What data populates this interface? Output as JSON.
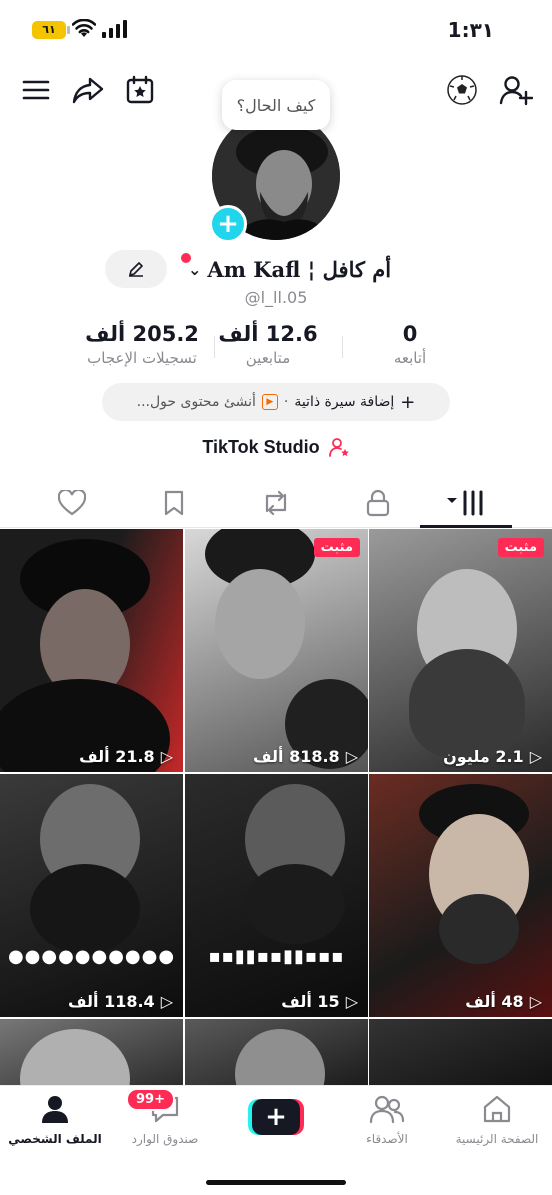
{
  "status_bar": {
    "time": "1:٣١",
    "battery": "٦١"
  },
  "profile": {
    "note_bubble": "كيف الحال؟",
    "display_name": "أم كافل ¦ Am Kafl",
    "username": "@l_ll.05",
    "stats": [
      {
        "value": "0",
        "label": "أتابعه"
      },
      {
        "value": "12.6 ألف",
        "label": "متابعين"
      },
      {
        "value": "205.2 ألف",
        "label": "تسجيلات الإعجاب"
      }
    ],
    "bio_add": "إضافة سيرة ذاتية",
    "bio_create": "أنشئ محتوى حول...",
    "studio_label": "TikTok Studio"
  },
  "videos": [
    {
      "views": "2.1 مليون",
      "pinned": "مثبت"
    },
    {
      "views": "818.8 ألف",
      "pinned": "مثبت"
    },
    {
      "views": "21.8 ألف",
      "pinned": ""
    },
    {
      "views": "48 ألف",
      "pinned": ""
    },
    {
      "views": "15 ألف",
      "pinned": ""
    },
    {
      "views": "118.4 ألف",
      "pinned": ""
    }
  ],
  "bottom_nav": {
    "home": "الصفحة الرئيسية",
    "friends": "الأصدقاء",
    "inbox": "صندوق الوارد",
    "inbox_badge": "99+",
    "profile": "الملف الشخصي"
  }
}
